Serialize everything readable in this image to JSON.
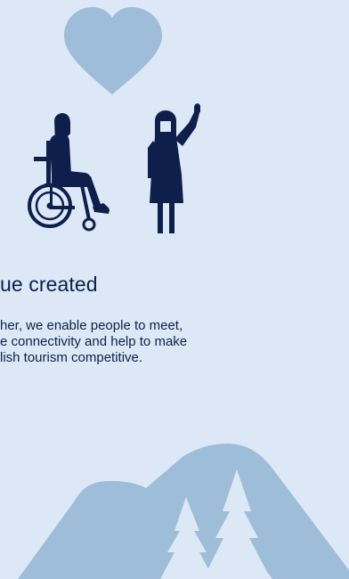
{
  "section": {
    "heading": "ue created",
    "body_lines": [
      "her, we enable people to meet,",
      "e connectivity and help to make",
      "lish tourism competitive."
    ]
  },
  "colors": {
    "background": "#dce8f6",
    "illustration_light": "#9dbdd8",
    "illustration_dark": "#0f1f4b",
    "text": "#0f1f4b"
  },
  "icons": [
    "heart-icon",
    "wheelchair-person-icon",
    "waving-person-icon",
    "mountain-icon",
    "pine-tree-icon"
  ]
}
